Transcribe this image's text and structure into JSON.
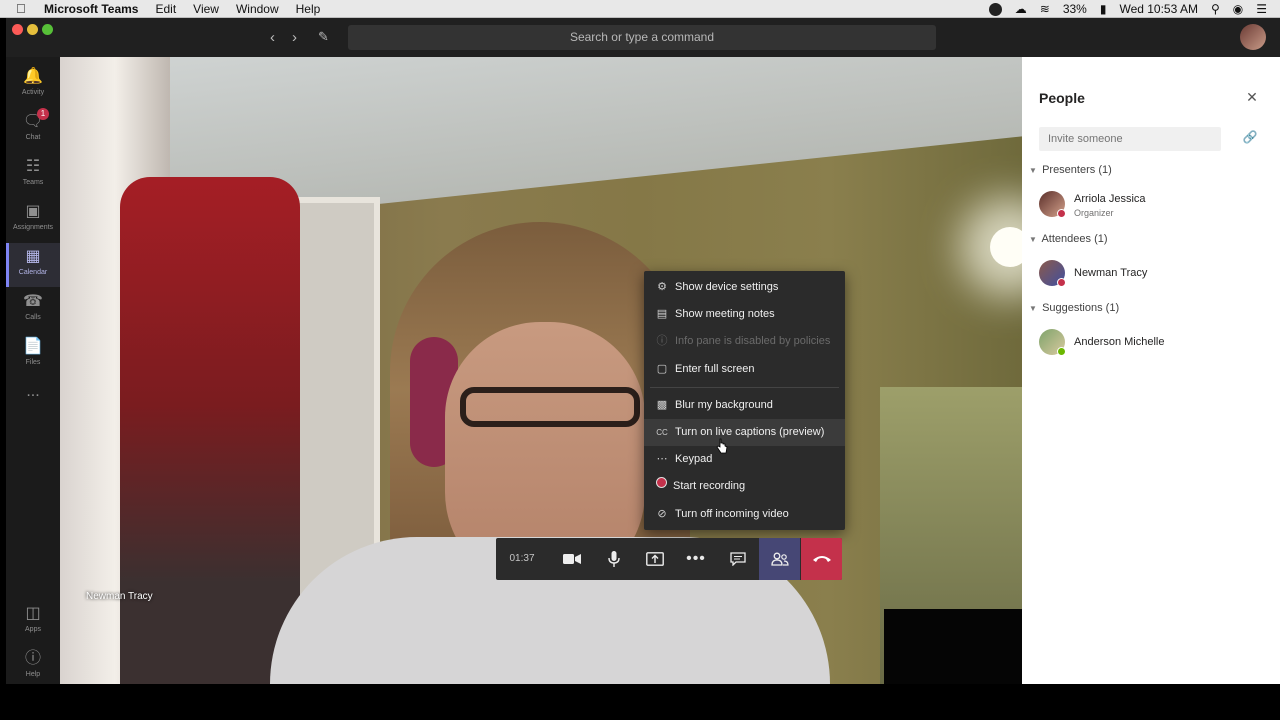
{
  "menubar": {
    "app_name": "Microsoft Teams",
    "items": [
      "Edit",
      "View",
      "Window",
      "Help"
    ],
    "battery": "33%",
    "clock": "Wed 10:53 AM"
  },
  "titlebar": {
    "search_placeholder": "Search or type a command"
  },
  "rail": {
    "items": [
      {
        "label": "Activity",
        "icon": "bell-icon"
      },
      {
        "label": "Chat",
        "icon": "chat-icon",
        "badge": "1"
      },
      {
        "label": "Teams",
        "icon": "teams-icon"
      },
      {
        "label": "Assignments",
        "icon": "assignments-icon"
      },
      {
        "label": "Calendar",
        "icon": "calendar-icon",
        "active": true
      },
      {
        "label": "Calls",
        "icon": "phone-icon"
      },
      {
        "label": "Files",
        "icon": "files-icon"
      },
      {
        "label": "...",
        "icon": "more-icon"
      },
      {
        "label": "Apps",
        "icon": "apps-icon"
      },
      {
        "label": "Help",
        "icon": "help-icon"
      }
    ]
  },
  "video": {
    "participant_name": "Newman Tracy"
  },
  "context_menu": {
    "items": [
      {
        "label": "Show device settings",
        "icon": "gear-icon"
      },
      {
        "label": "Show meeting notes",
        "icon": "notes-icon"
      },
      {
        "label": "Info pane is disabled by policies",
        "icon": "info-icon",
        "disabled": true
      },
      {
        "label": "Enter full screen",
        "icon": "fullscreen-icon"
      },
      {
        "label": "Blur my background",
        "icon": "blur-icon"
      },
      {
        "label": "Turn on live captions (preview)",
        "icon": "captions-icon",
        "hover": true
      },
      {
        "label": "Keypad",
        "icon": "keypad-icon"
      },
      {
        "label": "Start recording",
        "icon": "record-icon"
      },
      {
        "label": "Turn off incoming video",
        "icon": "video-off-icon"
      }
    ]
  },
  "callbar": {
    "timer": "01:37"
  },
  "people_panel": {
    "title": "People",
    "invite_placeholder": "Invite someone",
    "groups": [
      {
        "label": "Presenters",
        "count": "(1)",
        "members": [
          {
            "name": "Arriola Jessica",
            "role": "Organizer",
            "status_color": "#c4314b"
          }
        ]
      },
      {
        "label": "Attendees",
        "count": "(1)",
        "members": [
          {
            "name": "Newman Tracy",
            "status_color": "#c4314b"
          }
        ]
      },
      {
        "label": "Suggestions",
        "count": "(1)",
        "members": [
          {
            "name": "Anderson Michelle",
            "status_color": "#6bb700"
          }
        ]
      }
    ]
  },
  "colors": {
    "accent": "#6264a7",
    "hangup": "#c4314b",
    "busy": "#c4314b",
    "available": "#6bb700"
  }
}
